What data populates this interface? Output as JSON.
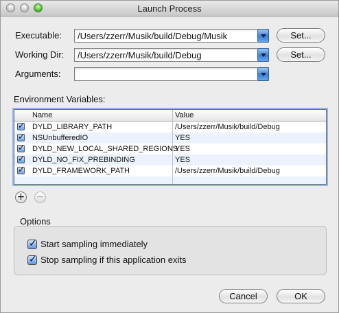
{
  "window": {
    "title": "Launch Process"
  },
  "form": {
    "executable": {
      "label": "Executable:",
      "value": "/Users/zzerr/Musik/build/Debug/Musik",
      "button": "Set..."
    },
    "working_dir": {
      "label": "Working Dir:",
      "value": "/Users/zzerr/Musik/build/Debug",
      "button": "Set..."
    },
    "arguments": {
      "label": "Arguments:",
      "value": ""
    }
  },
  "env": {
    "label": "Environment Variables:",
    "columns": [
      "Name",
      "Value"
    ],
    "rows": [
      {
        "name": "DYLD_LIBRARY_PATH",
        "value": "/Users/zzerr/Musik/build/Debug"
      },
      {
        "name": "NSUnbufferedIO",
        "value": "YES"
      },
      {
        "name": "DYLD_NEW_LOCAL_SHARED_REGIONS",
        "value": "YES"
      },
      {
        "name": "DYLD_NO_FIX_PREBINDING",
        "value": "YES"
      },
      {
        "name": "DYLD_FRAMEWORK_PATH",
        "value": "/Users/zzerr/Musik/build/Debug"
      }
    ],
    "add_symbol": "+",
    "remove_symbol": "−"
  },
  "options": {
    "label": "Options",
    "start_sampling": "Start sampling immediately",
    "stop_sampling": "Stop sampling if this application exits"
  },
  "footer": {
    "cancel": "Cancel",
    "ok": "OK"
  }
}
